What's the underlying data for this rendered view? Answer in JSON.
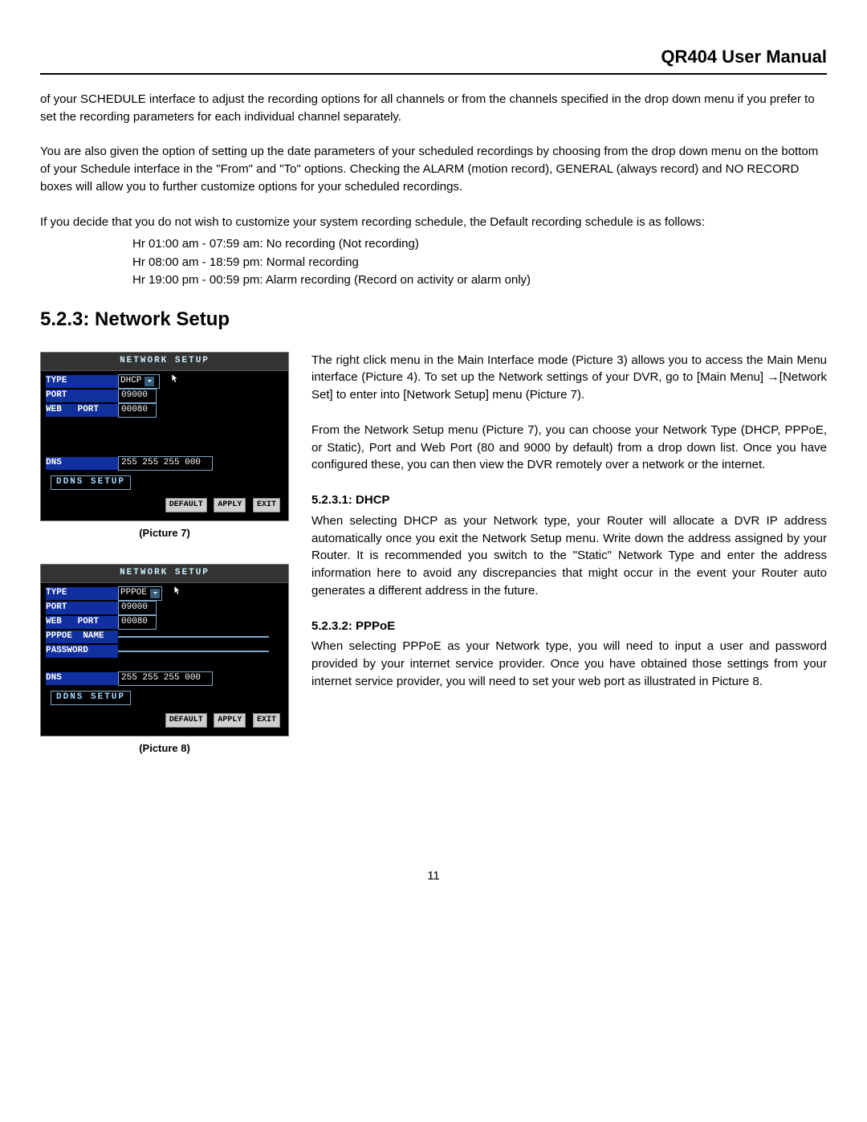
{
  "header": {
    "title": "QR404 User Manual"
  },
  "intro": {
    "p1": "of your SCHEDULE interface to adjust the recording options for all channels or from the channels specified in the drop down menu if you prefer to set the recording parameters for each individual channel separately.",
    "p2": "You are also given the option of setting up the date parameters of your scheduled recordings by choosing from the drop down menu on the bottom of your Schedule interface in the \"From\" and \"To\" options.   Checking the ALARM (motion record), GENERAL (always record) and NO RECORD boxes will allow you to further customize options for your scheduled recordings.",
    "p3": "If you decide that you do not wish to customize your system recording schedule, the Default recording schedule is as follows:",
    "schedule": [
      "Hr 01:00 am - 07:59 am: No recording (Not recording)",
      "Hr 08:00 am - 18:59 pm: Normal recording",
      "Hr 19:00 pm - 00:59 pm: Alarm recording (Record on activity or alarm only)"
    ]
  },
  "section": {
    "title": "5.2.3: Network Setup"
  },
  "pic7": {
    "title": "NETWORK  SETUP",
    "rows": {
      "type_label": "TYPE",
      "type_value": "DHCP",
      "port_label": "PORT",
      "port_value": "09000",
      "web_label": "WEB   PORT",
      "web_value": "00080",
      "dns_label": "DNS",
      "dns_value": "255 255 255 000"
    },
    "ddns": "DDNS  SETUP",
    "buttons": {
      "default": "DEFAULT",
      "apply": "APPLY",
      "exit": "EXIT"
    },
    "caption": "(Picture 7)"
  },
  "pic8": {
    "title": "NETWORK  SETUP",
    "rows": {
      "type_label": "TYPE",
      "type_value": "PPPOE",
      "port_label": "PORT",
      "port_value": "09000",
      "web_label": "WEB   PORT",
      "web_value": "00080",
      "pppoe_name_label": "PPPOE  NAME",
      "password_label": "PASSWORD",
      "dns_label": "DNS",
      "dns_value": "255 255 255 000"
    },
    "ddns": "DDNS  SETUP",
    "buttons": {
      "default": "DEFAULT",
      "apply": "APPLY",
      "exit": "EXIT"
    },
    "caption": "(Picture 8)"
  },
  "right": {
    "p1": "The right click menu in the Main Interface mode (Picture 3) allows you to access the Main Menu interface (Picture 4). To set up the Network settings of your DVR, go to [Main Menu] →[Network Set] to enter into [Network Setup] menu (Picture 7).",
    "p2": "From the Network Setup menu (Picture 7), you can choose your Network Type (DHCP, PPPoE, or Static), Port and Web Port (80 and 9000 by default) from a drop down list.   Once you have configured these, you can then view the DVR remotely over a network or the internet.",
    "h1": "5.2.3.1: DHCP",
    "p3": "When selecting DHCP as your Network type, your Router will allocate a DVR IP address automatically once you exit the Network Setup menu.  Write down the address assigned by your Router.  It is recommended you switch to the \"Static\" Network Type and enter the address information here to avoid any discrepancies that might occur in the event your Router auto generates a different address in the future.",
    "h2": "5.2.3.2: PPPoE",
    "p4": "When selecting PPPoE as your Network type, you will need to input a user and password provided by your internet service provider.   Once you have obtained those settings from your internet service provider, you will need to set your web port as illustrated in Picture 8."
  },
  "page_number": "11"
}
